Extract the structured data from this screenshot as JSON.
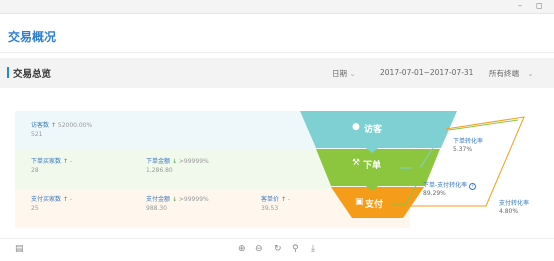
{
  "window": {
    "minimize": "–",
    "maximize": "◻"
  },
  "page": {
    "title": "交易概况"
  },
  "section": {
    "title": "交易总览",
    "filters": {
      "date_label": "日期",
      "date_range": "2017-07-01~2017-07-31",
      "terminal": "所有终端"
    }
  },
  "rows": {
    "visit": {
      "visitors": {
        "label": "访客数",
        "change": "52000.00%",
        "value": "521"
      }
    },
    "order": {
      "buyers": {
        "label": "下单买家数",
        "change": "-",
        "value": "28"
      },
      "amount": {
        "label": "下单金额",
        "change": ">99999%",
        "value": "1,286.80"
      }
    },
    "pay": {
      "buyers": {
        "label": "支付买家数",
        "change": "-",
        "value": "25"
      },
      "amount": {
        "label": "支付金额",
        "change": ">99999%",
        "value": "988.30"
      },
      "unit_price": {
        "label": "客单价",
        "change": "-",
        "value": "39.53"
      }
    }
  },
  "funnel": {
    "stages": [
      {
        "label": "访客",
        "color": "#7fd0d2"
      },
      {
        "label": "下单",
        "color": "#8cc63f"
      },
      {
        "label": "支付",
        "color": "#f59c1a"
      }
    ]
  },
  "rates": {
    "order_rate": {
      "label": "下单转化率",
      "value": "5.37%"
    },
    "order_pay_rate": {
      "label": "下单-支付转化率",
      "value": "89.29%"
    },
    "pay_rate": {
      "label": "支付转化率",
      "value": "4.80%"
    }
  },
  "toolbar": {
    "left_icon": "monitor-icon",
    "icons": [
      "zoom-in-icon",
      "zoom-out-icon",
      "refresh-icon",
      "search-icon",
      "download-icon"
    ]
  }
}
